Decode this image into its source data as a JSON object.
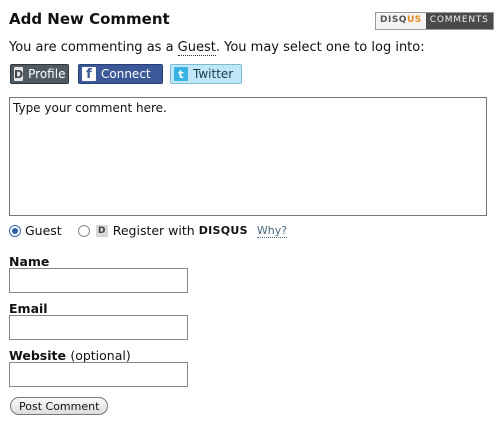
{
  "header": {
    "title": "Add New Comment",
    "brand_disq": "DISQ",
    "brand_us": "US",
    "brand_comments": "COMMENTS"
  },
  "intro": {
    "prefix": "You are commenting as a ",
    "guest": "Guest",
    "suffix": ". You may select one to log into:"
  },
  "login_buttons": [
    {
      "icon": "D",
      "label": "Profile"
    },
    {
      "icon": "f",
      "label": "Connect"
    },
    {
      "icon": "t",
      "label": "Twitter"
    }
  ],
  "comment": {
    "placeholder": "Type your comment here."
  },
  "identity": {
    "guest_label": "Guest",
    "guest_selected": true,
    "register_label": "Register with",
    "register_brand": "DISQUS",
    "why_link": "Why?"
  },
  "form": {
    "name_label": "Name",
    "email_label": "Email",
    "website_label": "Website",
    "website_optional": "(optional)",
    "name_value": "",
    "email_value": "",
    "website_value": ""
  },
  "submit": {
    "label": "Post Comment"
  }
}
